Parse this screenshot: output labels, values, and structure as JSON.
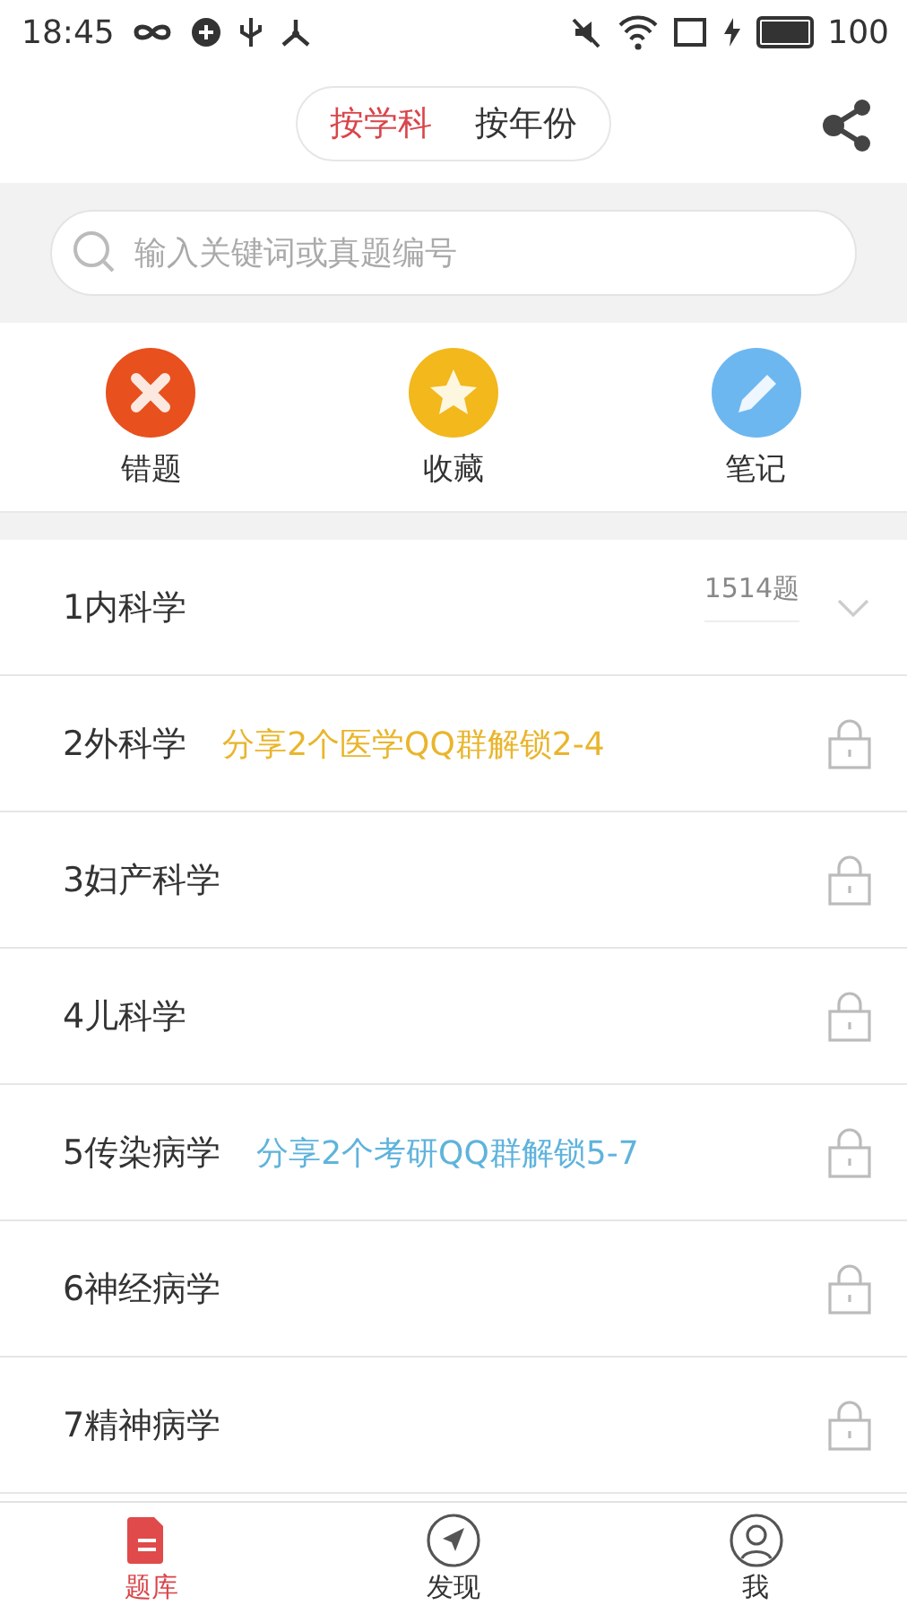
{
  "status_bar": {
    "time": "18:45",
    "battery": "100"
  },
  "header": {
    "tabs": [
      {
        "label": "按学科",
        "selected": true
      },
      {
        "label": "按年份",
        "selected": false
      }
    ]
  },
  "search": {
    "placeholder": "输入关键词或真题编号"
  },
  "shortcuts": [
    {
      "label": "错题",
      "kind": "wrong",
      "color": "#e8501e"
    },
    {
      "label": "收藏",
      "kind": "favorite",
      "color": "#f2b81c"
    },
    {
      "label": "笔记",
      "kind": "note",
      "color": "#6db7f0"
    }
  ],
  "subjects": [
    {
      "name": "1内科学",
      "count": "1514题",
      "locked": false
    },
    {
      "name": "2外科学",
      "promo": "分享2个医学QQ群解锁2-4",
      "color": "#e9b52c",
      "locked": true
    },
    {
      "name": "3妇产科学",
      "locked": true
    },
    {
      "name": "4儿科学",
      "locked": true
    },
    {
      "name": "5传染病学",
      "promo": "分享2个考研QQ群解锁5-7",
      "color": "#5fb3dc",
      "locked": true
    },
    {
      "name": "6神经病学",
      "locked": true
    },
    {
      "name": "7精神病学",
      "locked": true
    }
  ],
  "bottom_nav": [
    {
      "label": "题库",
      "kind": "bank",
      "selected": true
    },
    {
      "label": "发现",
      "kind": "discover",
      "selected": false
    },
    {
      "label": "我",
      "kind": "me",
      "selected": false
    }
  ]
}
